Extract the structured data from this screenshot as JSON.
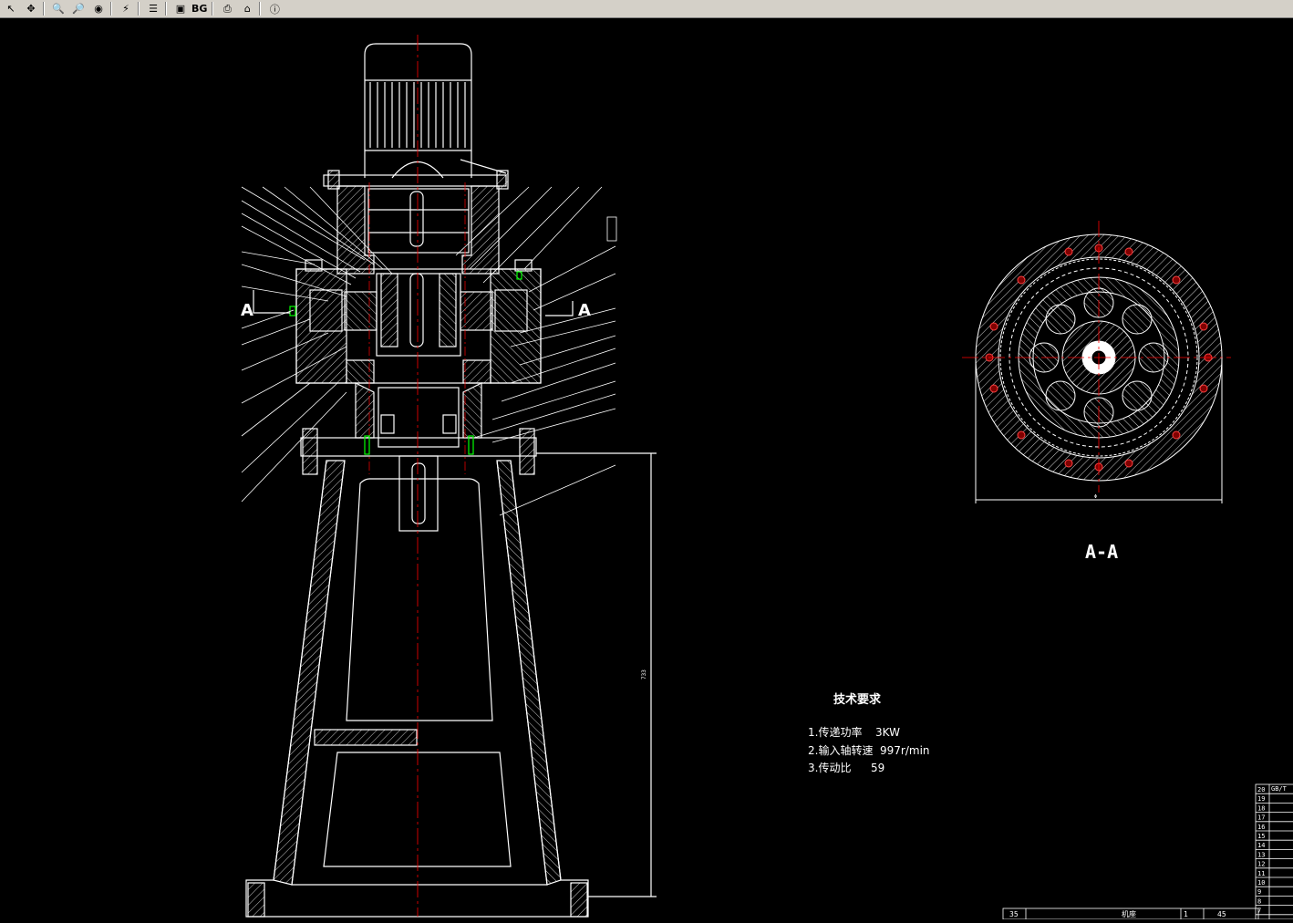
{
  "toolbar": {
    "bg_label": "BG"
  },
  "drawing": {
    "section_left": "A",
    "section_right": "A",
    "section_view_title": "A-A",
    "tech_title": "技术要求",
    "tech_lines": [
      {
        "label": "1.传递功率",
        "value": "3KW"
      },
      {
        "label": "2.输入轴转速",
        "value": "997r/min"
      },
      {
        "label": "3.传动比",
        "value": "59"
      }
    ],
    "bom_rows": [
      "20",
      "19",
      "18",
      "17",
      "16",
      "15",
      "14",
      "13",
      "12",
      "11",
      "10",
      "9",
      "8",
      "7"
    ],
    "bom_bottom": {
      "no": "35",
      "name": "机座",
      "qty": "1",
      "mat": "45"
    },
    "bom_partial": "GB/T"
  },
  "colors": {
    "background": "#000000",
    "line": "#ffffff",
    "center": "#ff0000",
    "accent_green": "#00ff00",
    "accent_yellow": "#ffff00"
  }
}
